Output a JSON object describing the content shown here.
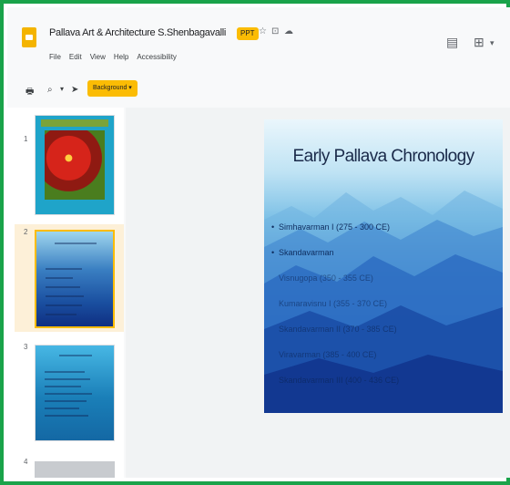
{
  "document": {
    "title": "Pallava Art & Architecture S.Shenbagavalli",
    "badge": "PPT"
  },
  "menu": [
    "File",
    "Edit",
    "View",
    "Help",
    "Accessibility"
  ],
  "toolbar": {
    "background_label": "Background ▾"
  },
  "filmstrip": {
    "slides": [
      {
        "number": "1"
      },
      {
        "number": "2",
        "selected": true
      },
      {
        "number": "3"
      },
      {
        "number": "4"
      }
    ]
  },
  "slide": {
    "title": "Early Pallava Chronology",
    "bullets": [
      "Simhavarman I (275 - 300 CE)",
      "Skandavarman",
      "Visnugopa (350 - 355 CE)",
      "Kumaravisnu I (355 - 370 CE)",
      "Skandavarman II (370 - 385 CE)",
      "Viravarman (385 - 400 CE)",
      "Skandavarman III (400 - 436 CE)"
    ]
  },
  "colors": {
    "frame": "#1aa34a",
    "accent": "#fbbc04",
    "doc_icon": "#f4b400",
    "slide_title": "#1a2a4a"
  }
}
